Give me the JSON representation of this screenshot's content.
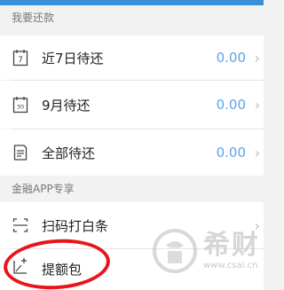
{
  "sections": [
    {
      "header": "我要还款",
      "items": [
        {
          "label": "近7日待还",
          "amount": "0.00",
          "icon": "calendar-7-icon",
          "icon_text": "7"
        },
        {
          "label": "9月待还",
          "amount": "0.00",
          "icon": "calendar-30-icon",
          "icon_text": "30"
        },
        {
          "label": "全部待还",
          "amount": "0.00",
          "icon": "document-icon"
        }
      ]
    },
    {
      "header": "金融APP专享",
      "items": [
        {
          "label": "扫码打白条",
          "icon": "scan-icon"
        },
        {
          "label": "提额包",
          "icon": "credit-boost-icon"
        }
      ]
    }
  ],
  "chevron": "›",
  "watermark": {
    "title": "希财",
    "url": "www.csai.cn"
  },
  "colors": {
    "accent": "#3a8fd8",
    "amount": "#5aa5e6",
    "highlight": "#e8141b"
  }
}
